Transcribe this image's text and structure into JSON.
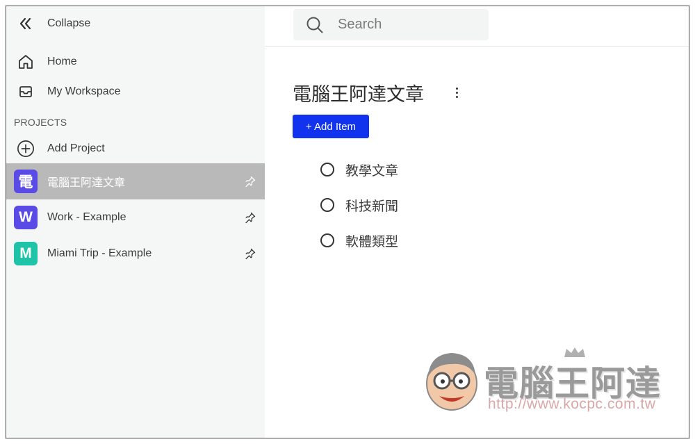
{
  "sidebar": {
    "collapse_label": "Collapse",
    "nav": [
      {
        "label": "Home",
        "icon": "home-icon"
      },
      {
        "label": "My Workspace",
        "icon": "inbox-icon"
      }
    ],
    "projects_heading": "PROJECTS",
    "add_project_label": "Add Project",
    "projects": [
      {
        "initial": "電",
        "label": "電腦王阿達文章",
        "color": "#5b4be6",
        "active": true
      },
      {
        "initial": "W",
        "label": "Work - Example",
        "color": "#5b4be6",
        "active": false
      },
      {
        "initial": "M",
        "label": "Miami Trip - Example",
        "color": "#1fc3a8",
        "active": false
      }
    ]
  },
  "search": {
    "placeholder": "Search"
  },
  "main": {
    "title": "電腦王阿達文章",
    "add_item_label": "+ Add Item",
    "items": [
      {
        "label": "教學文章"
      },
      {
        "label": "科技新聞"
      },
      {
        "label": "軟體類型"
      }
    ]
  },
  "watermark": {
    "text": "電腦王阿達",
    "url": "http://www.kocpc.com.tw"
  },
  "colors": {
    "sidebar_bg": "#f5f6f6",
    "active_row": "#b9b9b9",
    "primary_button": "#1133ee"
  }
}
